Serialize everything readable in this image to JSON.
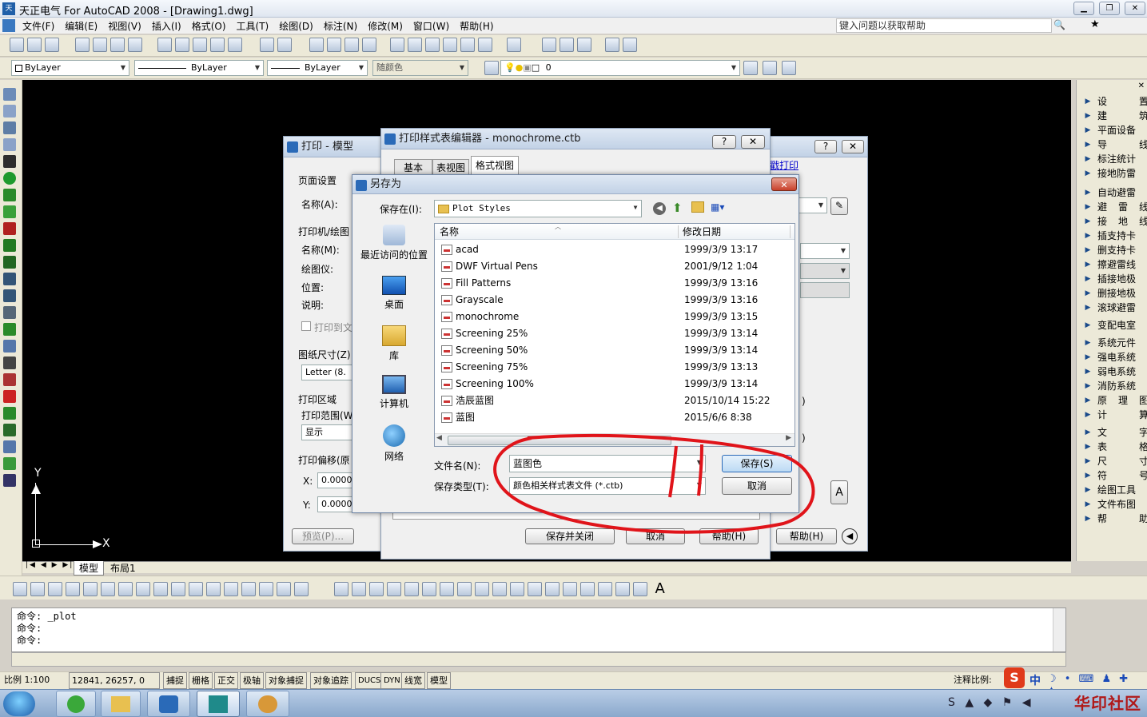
{
  "app": {
    "title": "天正电气 For AutoCAD 2008 - [Drawing1.dwg]",
    "menu": [
      "文件(F)",
      "编辑(E)",
      "视图(V)",
      "插入(I)",
      "格式(O)",
      "工具(T)",
      "绘图(D)",
      "标注(N)",
      "修改(M)",
      "窗口(W)",
      "帮助(H)"
    ],
    "help_search_placeholder": "键入问题以获取帮助"
  },
  "props": {
    "color": "ByLayer",
    "linetype": "ByLayer",
    "lineweight": "ByLayer",
    "plotstyle": "随颜色",
    "layer": "0"
  },
  "canvas": {
    "axis_y": "Y",
    "axis_x": "X",
    "tabs": [
      "模型",
      "布局1"
    ]
  },
  "command": {
    "lines": [
      "命令: _plot",
      "命令:",
      "命令:"
    ]
  },
  "status": {
    "scale": "比例 1:100",
    "coords": "12841, 26257, 0",
    "toggles": [
      "捕捉",
      "栅格",
      "正交",
      "极轴",
      "对象捕捉",
      "对象追踪",
      "DUCS",
      "DYN",
      "线宽",
      "模型"
    ],
    "annotation_scale": "注释比例:"
  },
  "plot_dialog": {
    "title": "打印 - 模型",
    "page_setup": "页面设置",
    "name_label": "名称(A):",
    "printer_section": "打印机/绘图",
    "printer_name": "名称(M):",
    "plotter": "绘图仪:",
    "where": "位置:",
    "desc": "说明:",
    "print_to_file": "打印到文",
    "paper_size": "图纸尺寸(Z)",
    "paper_value": "Letter (8.",
    "plot_area": "打印区域",
    "plot_range": "打印范围(W)",
    "plot_range_value": "显示",
    "plot_offset": "打印偏移(原",
    "x_label": "X:",
    "x_value": "0.00000",
    "y_label": "Y:",
    "y_value": "0.00000",
    "preview": "预览(P)...",
    "help": "帮助(H)",
    "link": "戳打印",
    "paren1": ")",
    "paren2": ")"
  },
  "style_editor": {
    "title": "打印样式表编辑器 - monochrome.ctb",
    "tabs": [
      "基本",
      "表视图",
      "格式视图"
    ],
    "save_close": "保存并关闭",
    "cancel": "取消",
    "help": "帮助(H)"
  },
  "saveas": {
    "title": "另存为",
    "save_in_label": "保存在(I):",
    "save_in_value": "Plot Styles",
    "places": [
      "最近访问的位置",
      "桌面",
      "库",
      "计算机",
      "网络"
    ],
    "col_name": "名称",
    "col_date": "修改日期",
    "files": [
      {
        "name": "acad",
        "date": "1999/3/9 13:17"
      },
      {
        "name": "DWF Virtual Pens",
        "date": "2001/9/12 1:04"
      },
      {
        "name": "Fill Patterns",
        "date": "1999/3/9 13:16"
      },
      {
        "name": "Grayscale",
        "date": "1999/3/9 13:16"
      },
      {
        "name": "monochrome",
        "date": "1999/3/9 13:15"
      },
      {
        "name": "Screening 25%",
        "date": "1999/3/9 13:14"
      },
      {
        "name": "Screening 50%",
        "date": "1999/3/9 13:14"
      },
      {
        "name": "Screening 75%",
        "date": "1999/3/9 13:13"
      },
      {
        "name": "Screening 100%",
        "date": "1999/3/9 13:14"
      },
      {
        "name": "浩辰蓝图",
        "date": "2015/10/14 15:22"
      },
      {
        "name": "蓝图",
        "date": "2015/6/6 8:38"
      }
    ],
    "filename_label": "文件名(N):",
    "filename_value": "蓝图色",
    "filetype_label": "保存类型(T):",
    "filetype_value": "颜色相关样式表文件 (*.ctb)",
    "save": "保存(S)",
    "cancel": "取消"
  },
  "right_panel": {
    "items": [
      "设置",
      "建筑",
      "平面设备",
      "导线",
      "标注统计",
      "接地防雷",
      "自动避雷",
      "避雷线",
      "接地线",
      "插支持卡",
      "删支持卡",
      "擦避雷线",
      "插接地极",
      "删接地极",
      "滚球避雷",
      "变配电室",
      "系统元件",
      "强电系统",
      "弱电系统",
      "消防系统",
      "原理图",
      "计算",
      "文字",
      "表格",
      "尺寸",
      "符号",
      "绘图工具",
      "文件布图",
      "帮助"
    ]
  },
  "taskbar": {
    "watermark": "华印社区",
    "ime": "中"
  },
  "colors": {
    "annotation_red": "#e0141a",
    "canvas": "#000000",
    "title_blue": "#2a6ab8"
  }
}
